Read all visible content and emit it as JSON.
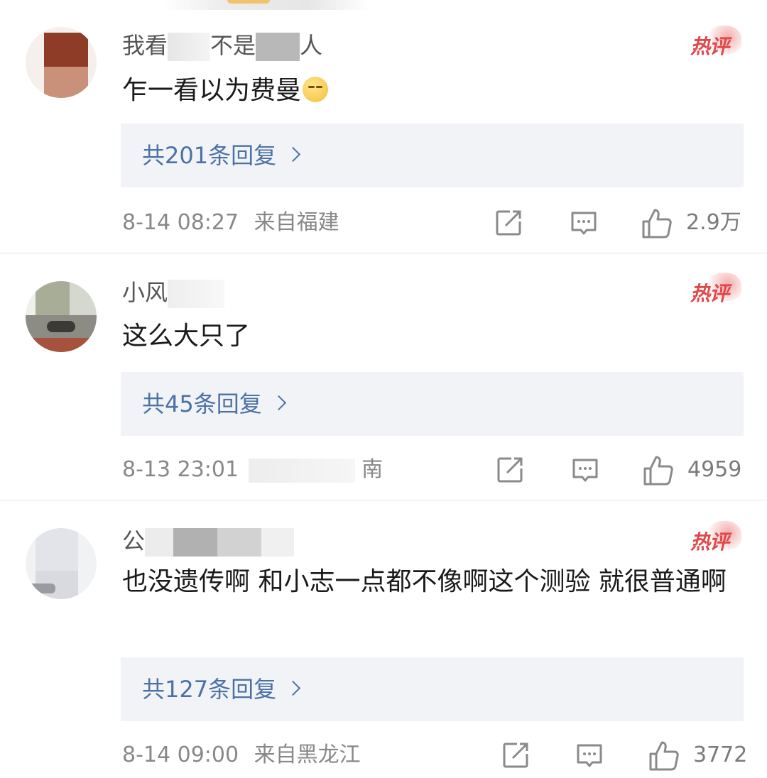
{
  "comments": [
    {
      "username": "我看不是人",
      "username_parts": [
        "我看",
        "不是",
        "人"
      ],
      "hot_label": "热评",
      "content": "乍一看以为费曼",
      "emoji": "meh-face-emoji",
      "reply_label": "共201条回复",
      "time": "8-14 08:27",
      "location": "来自福建",
      "likes": "2.9万"
    },
    {
      "username": "小风",
      "username_parts": [
        "小风"
      ],
      "hot_label": "热评",
      "content": "这么大只了",
      "reply_label": "共45条回复",
      "time": "8-13 23:01",
      "location_partial": "南",
      "likes": "4959"
    },
    {
      "username": "公",
      "username_parts": [
        "公"
      ],
      "hot_label": "热评",
      "content": "也没遗传啊 和小志一点都不像啊这个测验 就很普通啊",
      "reply_label": "共127条回复",
      "time": "8-14 09:00",
      "location": "来自黑龙江",
      "likes": "3772"
    }
  ],
  "icons": {
    "repost": "repost-icon",
    "comment": "comment-icon",
    "like": "thumbs-up-icon",
    "reply_arrow": "chevron-right-icon"
  },
  "colors": {
    "reply_link": "#4b72a6",
    "hot_badge": "#e0484a",
    "reply_bg": "#f2f3f6",
    "meta_text": "#888888"
  }
}
